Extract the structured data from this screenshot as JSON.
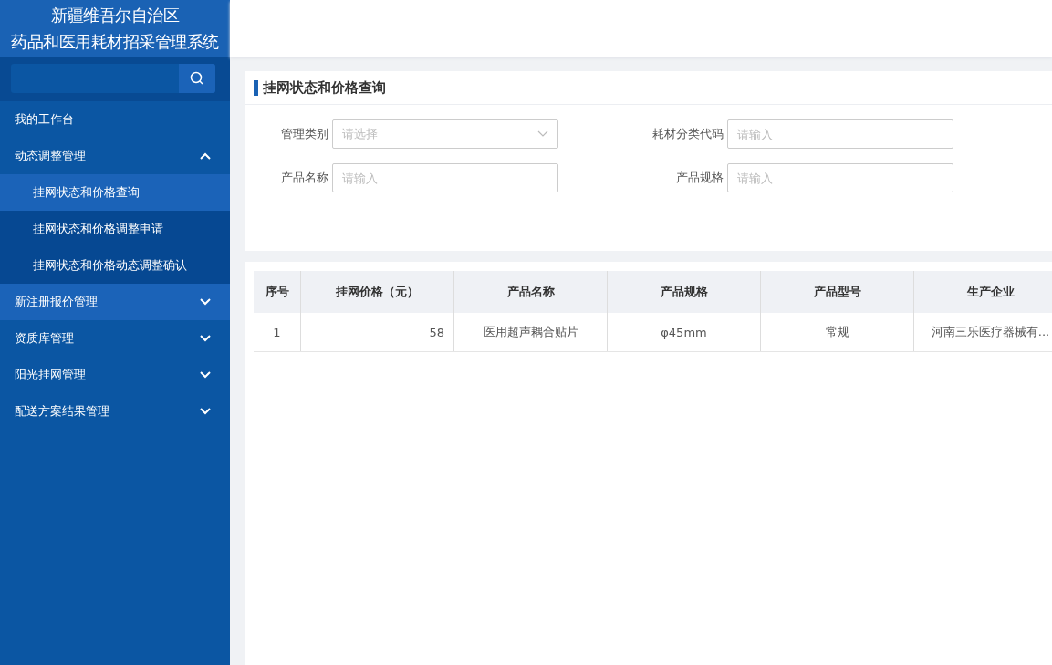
{
  "sidebar": {
    "title_lines": [
      "新疆维吾尔自治区",
      "药品和医用耗材招采管理系统"
    ],
    "menu": [
      {
        "label": "我的工作台",
        "highlighted": false
      },
      {
        "label": "动态调整管理",
        "expanded": true,
        "highlighted": false,
        "children": [
          {
            "label": "挂网状态和价格查询",
            "selected": true
          },
          {
            "label": "挂网状态和价格调整申请",
            "selected": false
          },
          {
            "label": "挂网状态和价格动态调整确认",
            "selected": false
          }
        ]
      },
      {
        "label": "新注册报价管理",
        "expanded": false,
        "highlighted": true
      },
      {
        "label": "资质库管理",
        "expanded": false,
        "highlighted": false
      },
      {
        "label": "阳光挂网管理",
        "expanded": false,
        "highlighted": false
      },
      {
        "label": "配送方案结果管理",
        "expanded": false,
        "highlighted": false
      }
    ]
  },
  "page_title": "挂网状态和价格查询",
  "filters": [
    {
      "label": "管理类别",
      "kind": "select",
      "placeholder": "请选择"
    },
    {
      "label": "耗材分类代码",
      "kind": "input",
      "placeholder": "请输入"
    },
    {
      "label": "产品名称",
      "kind": "input",
      "placeholder": "请输入"
    },
    {
      "label": "产品规格",
      "kind": "input",
      "placeholder": "请输入"
    }
  ],
  "table": {
    "columns": [
      "序号",
      "挂网价格（元）",
      "产品名称",
      "产品规格",
      "产品型号",
      "生产企业"
    ],
    "rows": [
      [
        "1",
        "58",
        "医用超声耦合贴片",
        "φ45mm",
        "常规",
        "河南三乐医疗器械有..."
      ]
    ]
  }
}
